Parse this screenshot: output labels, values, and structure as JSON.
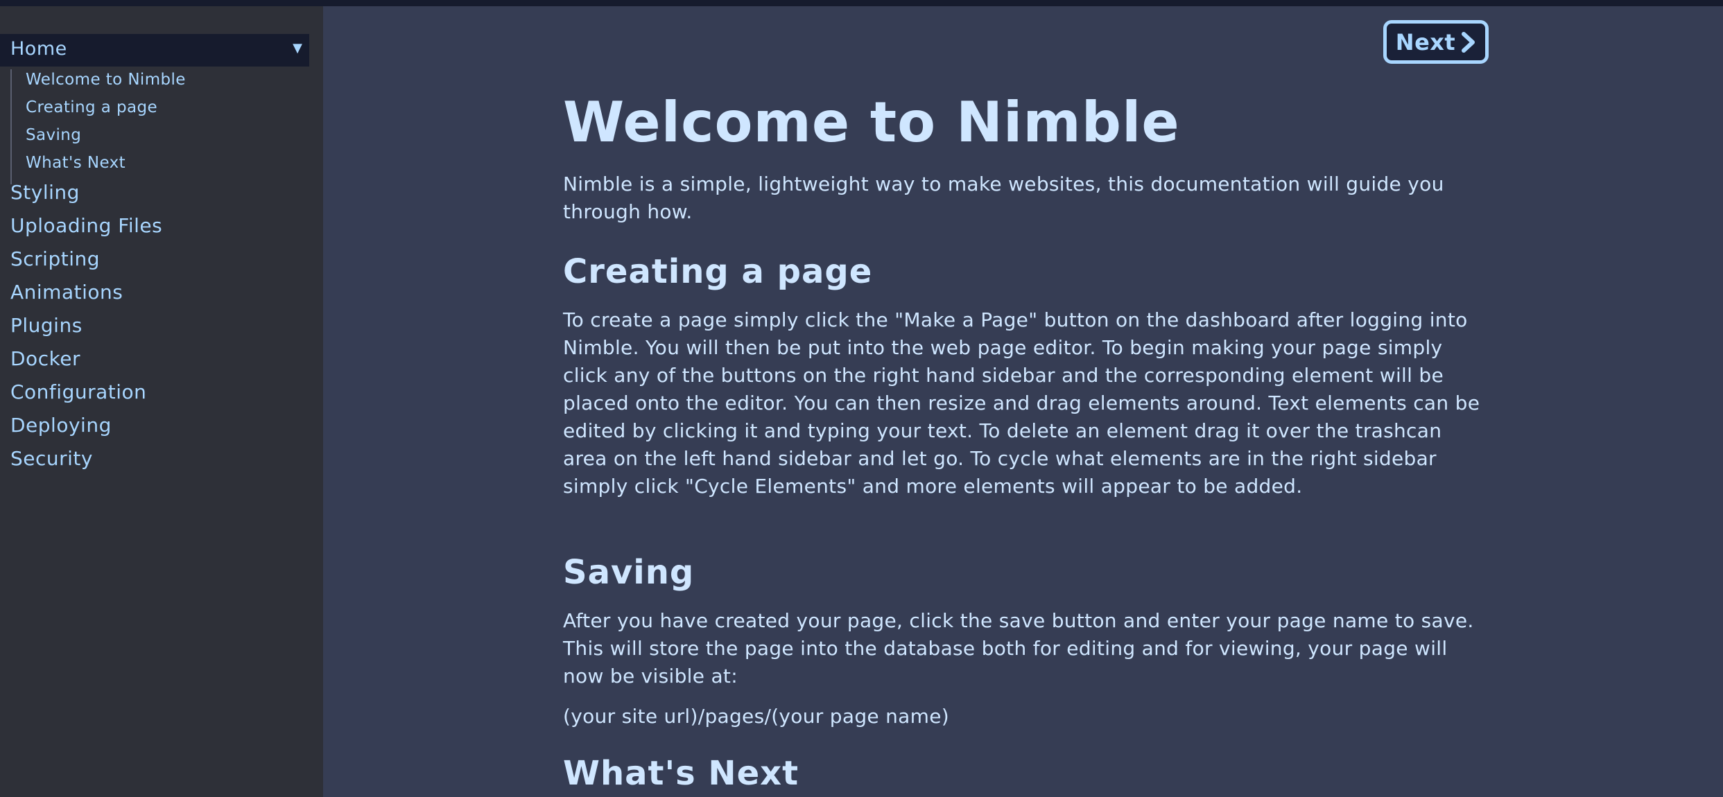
{
  "sidebar": {
    "home_label": "Home",
    "home_caret": "▼",
    "sub_items": [
      {
        "label": "Welcome to Nimble"
      },
      {
        "label": "Creating a page"
      },
      {
        "label": "Saving"
      },
      {
        "label": "What's Next"
      }
    ],
    "items": [
      {
        "label": "Styling"
      },
      {
        "label": "Uploading Files"
      },
      {
        "label": "Scripting"
      },
      {
        "label": "Animations"
      },
      {
        "label": "Plugins"
      },
      {
        "label": "Docker"
      },
      {
        "label": "Configuration"
      },
      {
        "label": "Deploying"
      },
      {
        "label": "Security"
      }
    ]
  },
  "nav": {
    "next_label": "Next",
    "next_icon": "chevron-right-icon"
  },
  "content": {
    "title": "Welcome to Nimble",
    "intro": "Nimble is a simple, lightweight way to make websites, this documentation will guide you through how.",
    "sections": [
      {
        "heading": "Creating a page",
        "body": "To create a page simply click the \"Make a Page\" button on the dashboard after logging into Nimble. You will then be put into the web page editor. To begin making your page simply click any of the buttons on the right hand sidebar and the corresponding element will be placed onto the editor. You can then resize and drag elements around. Text elements can be edited by clicking it and typing your text. To delete an element drag it over the trashcan area on the left hand sidebar and let go. To cycle what elements are in the right sidebar simply click \"Cycle Elements\" and more elements will appear to be added."
      },
      {
        "heading": "Saving",
        "body": "After you have created your page, click the save button and enter your page name to save. This will store the page into the database both for editing and for viewing, your page will now be visible at:",
        "url_line": "(your site url)/pages/(your page name)"
      },
      {
        "heading": "What's Next"
      }
    ]
  },
  "colors": {
    "background": "#363d54",
    "sidebar": "#2e3038",
    "accent": "#a8d6ff",
    "text": "#cfe6ff",
    "topbar": "#161b2d"
  }
}
